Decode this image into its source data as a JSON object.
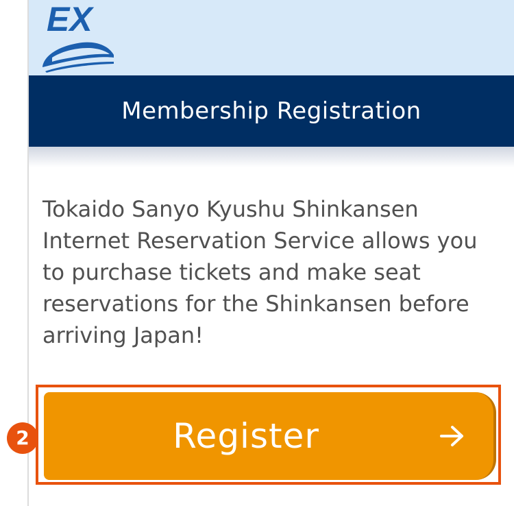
{
  "logo": {
    "text": "EX",
    "icon": "shinkansen-train-icon"
  },
  "header": {
    "title": "Membership Registration"
  },
  "main": {
    "description": "Tokaido Sanyo Kyushu Shinkansen Internet Reservation Service allows you to purchase tickets and make seat reservations for the Shinkansen before arriving Japan!",
    "register_button": {
      "label": "Register",
      "icon": "arrow-right-icon"
    }
  },
  "annotation": {
    "step_number": "2"
  },
  "colors": {
    "header_background": "#002e63",
    "logo_background": "#d7e9f9",
    "button_background": "#f09500",
    "highlight": "#e8520e",
    "logo_blue": "#1c5fae"
  }
}
